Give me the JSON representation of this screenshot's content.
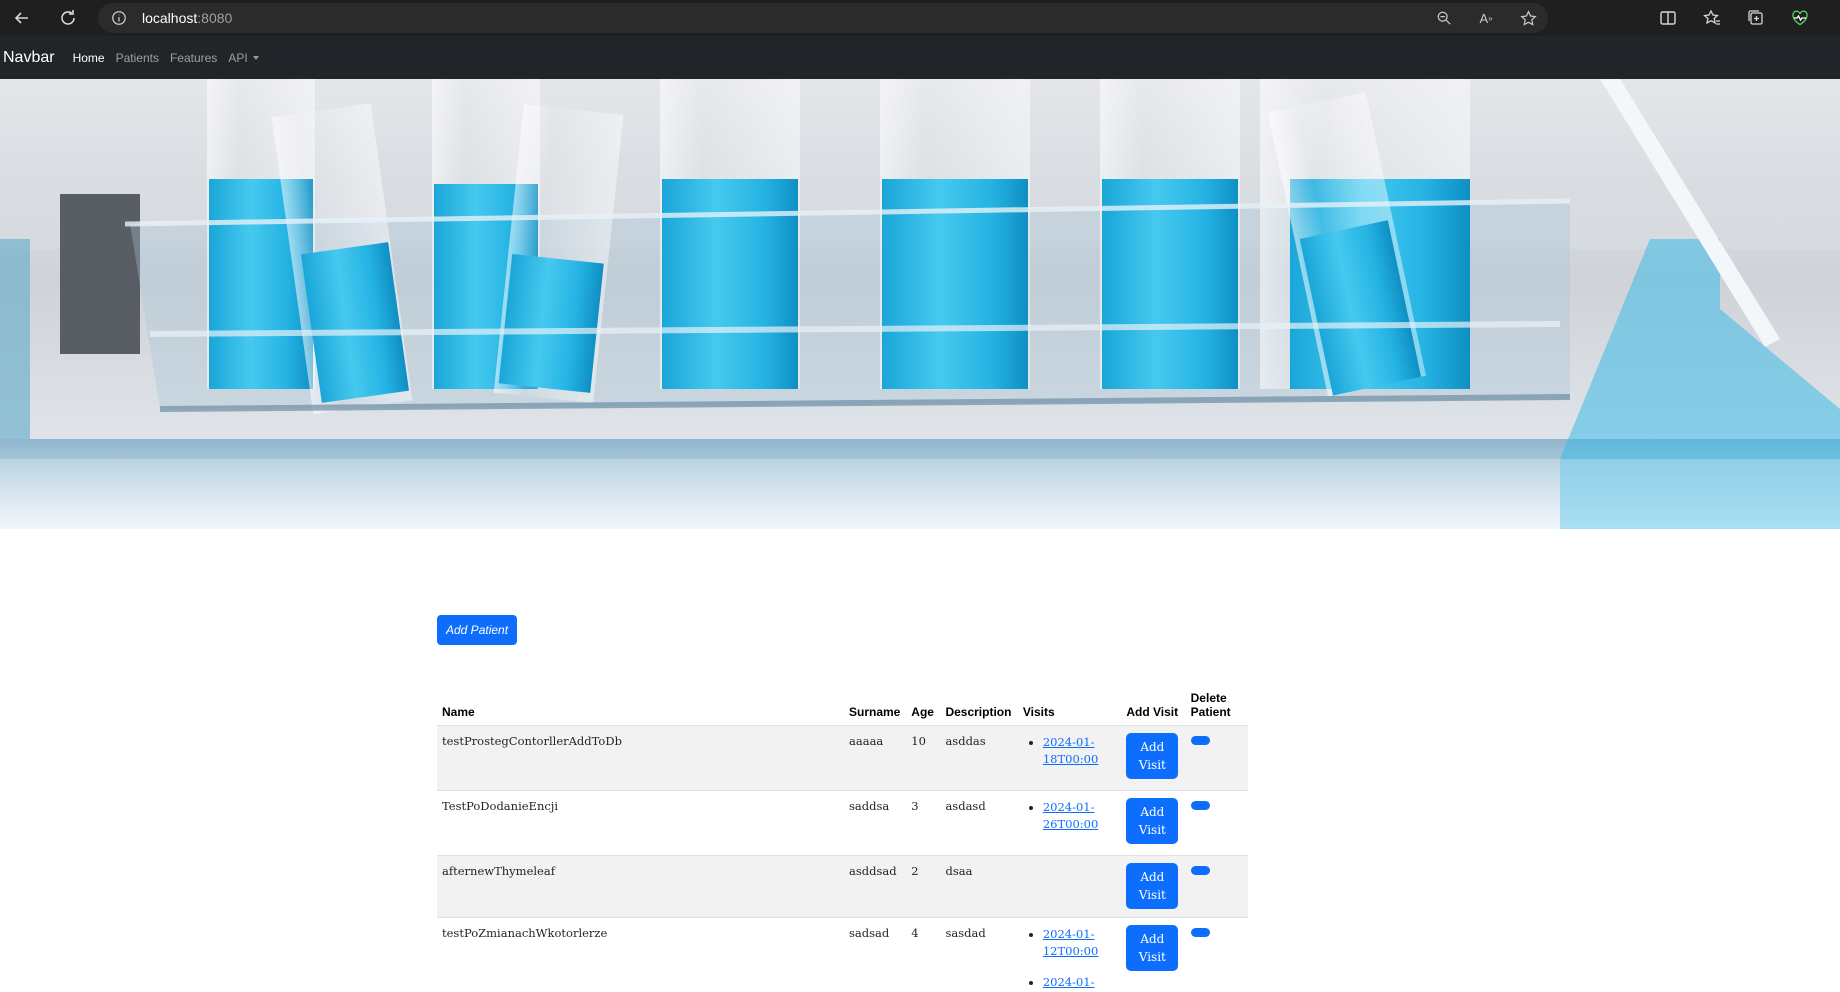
{
  "browser": {
    "address_host": "localhost",
    "address_port": ":8080",
    "icons": [
      "back-icon",
      "reload-icon",
      "info-icon",
      "zoom-out-icon",
      "read-aloud-icon",
      "favorite-star-icon",
      "split-screen-icon",
      "favorites-icon",
      "collections-icon",
      "health-icon"
    ]
  },
  "navbar": {
    "brand": "Navbar",
    "links": [
      {
        "label": "Home",
        "active": true
      },
      {
        "label": "Patients",
        "active": false
      },
      {
        "label": "Features",
        "active": false
      },
      {
        "label": "API",
        "active": false,
        "dropdown": true
      }
    ]
  },
  "hero": {
    "description": "lab-test-tubes-image"
  },
  "main": {
    "add_patient_label": "Add Patient",
    "table": {
      "headers": {
        "name": "Name",
        "surname": "Surname",
        "age": "Age",
        "description": "Description",
        "visits": "Visits",
        "add_visit": "Add Visit",
        "delete_line1": "Delete",
        "delete_line2": "Patient"
      },
      "add_visit_line1": "Add",
      "add_visit_line2": "Visit",
      "rows": [
        {
          "name": "testProstegContorllerAddToDb",
          "surname": "aaaaa",
          "age": "10",
          "description": "asddas",
          "visits": [
            [
              "2024-01-",
              "18T00:00"
            ]
          ]
        },
        {
          "name": "TestPoDodanieEncji",
          "surname": "saddsa",
          "age": "3",
          "description": "asdasd",
          "visits": [
            [
              "2024-01-",
              "26T00:00"
            ]
          ]
        },
        {
          "name": "afternewThymeleaf",
          "surname": "asddsad",
          "age": "2",
          "description": "dsaa",
          "visits": []
        },
        {
          "name": "testPoZmianachWkotorlerze",
          "surname": "sadsad",
          "age": "4",
          "description": "sasdad",
          "visits": [
            [
              "2024-01-",
              "12T00:00"
            ],
            [
              "2024-01-",
              ""
            ]
          ]
        }
      ]
    }
  },
  "colors": {
    "primary": "#0d6efd",
    "navbar_bg": "#212529",
    "browser_bg": "#1f1f1f",
    "stripe": "#f2f2f2"
  }
}
